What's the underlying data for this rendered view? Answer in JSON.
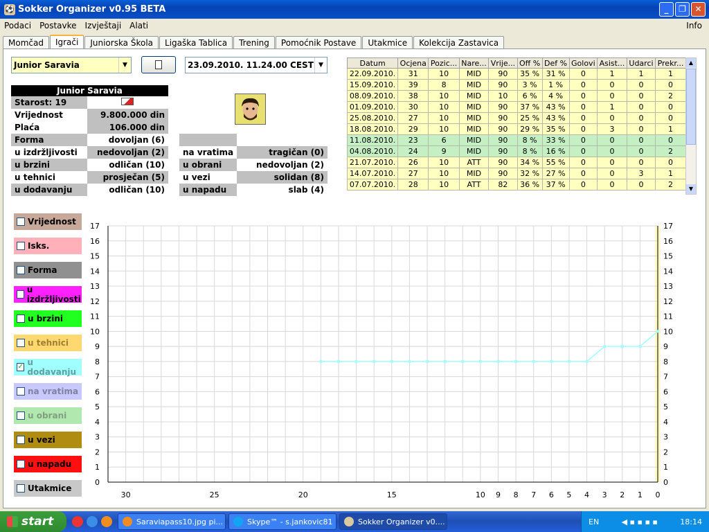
{
  "window": {
    "title": "Sokker Organizer v0.95 BETA"
  },
  "menu": [
    "Podaci",
    "Postavke",
    "Izvještaji",
    "Alati"
  ],
  "menu_right": "Info",
  "tabs": [
    "Momčad",
    "Igrači",
    "Juniorska Škola",
    "Ligaška Tablica",
    "Trening",
    "Pomoćnik Postave",
    "Utakmice",
    "Kolekcija Zastavica"
  ],
  "player_select": "Junior Saravia",
  "date_select": "23.09.2010. 11.24.00 CEST",
  "player": {
    "name": "Junior Saravia",
    "age_label": "Starost: 19",
    "value_label": "Vrijednost",
    "value": "9.800.000 din",
    "wage_label": "Plaća",
    "wage": "106.000 din",
    "form_label": "Forma",
    "form": "dovoljan (6)",
    "skills_left": [
      {
        "k": "u izdržljivosti",
        "v": "nedovoljan (2)"
      },
      {
        "k": "u brzini",
        "v": "odličan (10)"
      },
      {
        "k": "u tehnici",
        "v": "prosječan (5)"
      },
      {
        "k": "u dodavanju",
        "v": "odličan (10)"
      }
    ],
    "skills_right": [
      {
        "k": "na vratima",
        "v": "tragičan (0)"
      },
      {
        "k": "u obrani",
        "v": "nedovoljan (2)"
      },
      {
        "k": "u vezi",
        "v": "solidan (8)"
      },
      {
        "k": "u napadu",
        "v": "slab (4)"
      }
    ]
  },
  "history": {
    "columns": [
      "Datum",
      "Ocjena",
      "Pozic...",
      "Nare...",
      "Vrije...",
      "Off %",
      "Def %",
      "Golovi",
      "Asist...",
      "Udarci",
      "Prekr..."
    ],
    "rows": [
      [
        "22.09.2010.",
        "31",
        "10",
        "MID",
        "90",
        "35 %",
        "31 %",
        "0",
        "1",
        "1",
        "1"
      ],
      [
        "15.09.2010.",
        "39",
        "8",
        "MID",
        "90",
        "3 %",
        "1 %",
        "0",
        "0",
        "0",
        "0"
      ],
      [
        "08.09.2010.",
        "38",
        "10",
        "MID",
        "10",
        "6 %",
        "4 %",
        "0",
        "0",
        "0",
        "2"
      ],
      [
        "01.09.2010.",
        "30",
        "10",
        "MID",
        "90",
        "37 %",
        "43 %",
        "0",
        "1",
        "0",
        "0"
      ],
      [
        "25.08.2010.",
        "27",
        "10",
        "MID",
        "90",
        "25 %",
        "43 %",
        "0",
        "0",
        "0",
        "0"
      ],
      [
        "18.08.2010.",
        "29",
        "10",
        "MID",
        "90",
        "29 %",
        "35 %",
        "0",
        "3",
        "0",
        "1"
      ],
      [
        "11.08.2010.",
        "23",
        "6",
        "MID",
        "90",
        "8 %",
        "33 %",
        "0",
        "0",
        "0",
        "0"
      ],
      [
        "04.08.2010.",
        "24",
        "9",
        "MID",
        "90",
        "8 %",
        "16 %",
        "0",
        "0",
        "0",
        "2"
      ],
      [
        "21.07.2010.",
        "26",
        "10",
        "ATT",
        "90",
        "34 %",
        "55 %",
        "0",
        "0",
        "0",
        "0"
      ],
      [
        "14.07.2010.",
        "27",
        "10",
        "MID",
        "90",
        "32 %",
        "27 %",
        "0",
        "0",
        "3",
        "1"
      ],
      [
        "07.07.2010.",
        "28",
        "10",
        "ATT",
        "82",
        "36 %",
        "37 %",
        "0",
        "0",
        "0",
        "2"
      ]
    ],
    "green_rows": [
      6,
      7
    ]
  },
  "legend": [
    {
      "label": "Vrijednost",
      "color": "#c8a898",
      "text": "#000000",
      "checked": false
    },
    {
      "label": "Isks.",
      "color": "#ffb0b8",
      "text": "#000000",
      "checked": false
    },
    {
      "label": "Forma",
      "color": "#909090",
      "text": "#000000",
      "checked": false
    },
    {
      "label": "u izdržljivosti",
      "color": "#ff20ff",
      "text": "#000000",
      "checked": false
    },
    {
      "label": "u brzini",
      "color": "#20ff20",
      "text": "#000000",
      "checked": false
    },
    {
      "label": "u tehnici",
      "color": "#ffd870",
      "text": "#a08030",
      "checked": false
    },
    {
      "label": "u dodavanju",
      "color": "#a0ffff",
      "text": "#60a0a0",
      "checked": true
    },
    {
      "label": "na vratima",
      "color": "#c8c8ff",
      "text": "#8080a0",
      "checked": false
    },
    {
      "label": "u obrani",
      "color": "#b0e8b0",
      "text": "#80a080",
      "checked": false
    },
    {
      "label": "u vezi",
      "color": "#b08c10",
      "text": "#000000",
      "checked": false
    },
    {
      "label": "u napadu",
      "color": "#ff1010",
      "text": "#000000",
      "checked": false
    },
    {
      "label": "Utakmice",
      "color": "#c8c8c8",
      "text": "#000000",
      "checked": false
    }
  ],
  "chart_data": {
    "type": "line",
    "y_ticks": [
      0,
      1,
      2,
      3,
      4,
      5,
      6,
      7,
      8,
      9,
      10,
      11,
      12,
      13,
      14,
      15,
      16,
      17
    ],
    "ylim": [
      0,
      17
    ],
    "x_domain": [
      31,
      0
    ],
    "x_tick_labels": [
      "30",
      "25",
      "20",
      "15",
      "10",
      "9",
      "8",
      "7",
      "6",
      "5",
      "4",
      "3",
      "2",
      "1",
      "0"
    ],
    "series": [
      {
        "color": "#a0ffff",
        "x": [
          19,
          18,
          17,
          16,
          15,
          14,
          13,
          12,
          11,
          10,
          9,
          8,
          7,
          6,
          5,
          4,
          3,
          2,
          1,
          0
        ],
        "values": [
          8,
          8,
          8,
          8,
          8,
          8,
          8,
          8,
          8,
          8,
          8,
          8,
          8,
          8,
          8,
          8,
          9,
          9,
          9,
          10
        ]
      }
    ],
    "highlight_x": 0,
    "grid": true
  },
  "taskbar": {
    "start": "start",
    "tasks": [
      "Saraviapass10.jpg pi...",
      "Skype™ - s.jankovic81",
      "Sokker Organizer v0...."
    ],
    "tray_lang": "EN",
    "clock": "18:14"
  }
}
